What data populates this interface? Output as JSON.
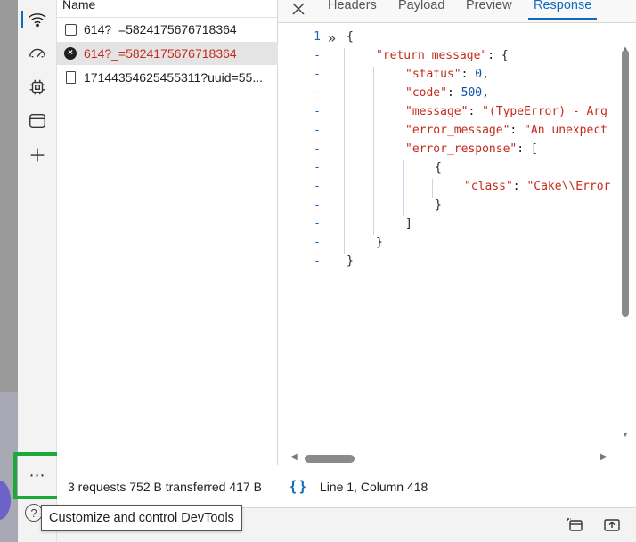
{
  "sidebar": {
    "icons": [
      "network-icon",
      "performance-icon",
      "cpu-icon",
      "window-icon",
      "add-icon"
    ],
    "more_label": "⋯",
    "help_label": "?"
  },
  "requests": {
    "header": "Name",
    "rows": [
      {
        "name": "614?_=5824175676718364",
        "icon": "checkbox-icon",
        "state": "normal"
      },
      {
        "name": "614?_=5824175676718364",
        "icon": "error-icon",
        "state": "error-selected"
      },
      {
        "name": "17144354625455311?uuid=55...",
        "icon": "document-icon",
        "state": "normal"
      }
    ]
  },
  "tabs": {
    "close_label": "✕",
    "items": [
      "Headers",
      "Payload",
      "Preview",
      "Response"
    ],
    "active": "Response"
  },
  "response": {
    "gutter": [
      "1",
      "-",
      "-",
      "-",
      "-",
      "-",
      "-",
      "-",
      "-",
      "-",
      "-",
      "-",
      "-"
    ],
    "lines": {
      "l0": "{",
      "l1_key": "\"return_message\"",
      "l1_rest": ": {",
      "l2_key": "\"status\"",
      "l2_sep": ": ",
      "l2_val": "0",
      "l2_end": ",",
      "l3_key": "\"code\"",
      "l3_sep": ": ",
      "l3_val": "500",
      "l3_end": ",",
      "l4_key": "\"message\"",
      "l4_sep": ": ",
      "l4_val": "\"(TypeError) - Arg",
      "l5_key": "\"error_message\"",
      "l5_sep": ": ",
      "l5_val": "\"An unexpect",
      "l6_key": "\"error_response\"",
      "l6_rest": ": [",
      "l7": "{",
      "l8_key": "\"class\"",
      "l8_sep": ": ",
      "l8_val": "\"Cake\\\\Error",
      "l9": "}",
      "l10": "]",
      "l11": "}",
      "l12": "}"
    }
  },
  "status": {
    "summary": "3 requests  752 B transferred  417 B",
    "braces": "{ }",
    "position": "Line 1, Column 418"
  },
  "tooltip": "Customize and control DevTools",
  "colors": {
    "accent": "#0f6cbd",
    "error": "#c42b1c",
    "highlight": "#1da83a"
  }
}
